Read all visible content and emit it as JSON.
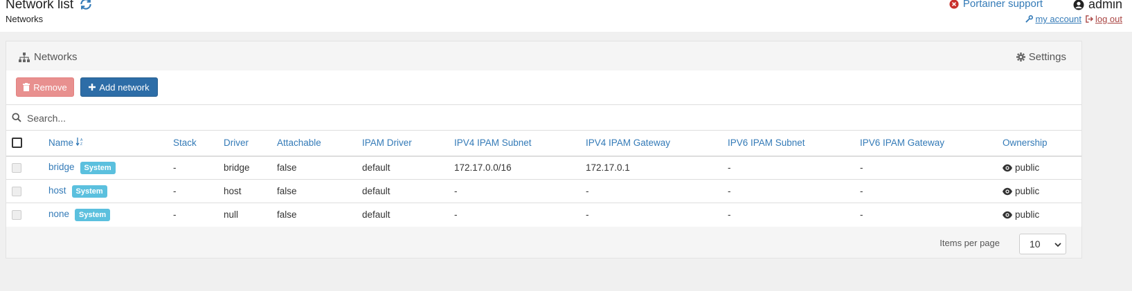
{
  "header": {
    "title": "Network list",
    "breadcrumb": "Networks",
    "support_label": "Portainer support",
    "username": "admin",
    "my_account": "my account",
    "log_out": "log out"
  },
  "panel": {
    "title": "Networks",
    "settings_label": "Settings",
    "remove_label": "Remove",
    "add_label": "Add network",
    "search_placeholder": "Search..."
  },
  "table": {
    "columns": [
      "Name",
      "Stack",
      "Driver",
      "Attachable",
      "IPAM Driver",
      "IPV4 IPAM Subnet",
      "IPV4 IPAM Gateway",
      "IPV6 IPAM Subnet",
      "IPV6 IPAM Gateway",
      "Ownership"
    ],
    "rows": [
      {
        "name": "bridge",
        "badge": "System",
        "stack": "-",
        "driver": "bridge",
        "attachable": "false",
        "ipam_driver": "default",
        "ipv4_subnet": "172.17.0.0/16",
        "ipv4_gateway": "172.17.0.1",
        "ipv6_subnet": "-",
        "ipv6_gateway": "-",
        "ownership": "public"
      },
      {
        "name": "host",
        "badge": "System",
        "stack": "-",
        "driver": "host",
        "attachable": "false",
        "ipam_driver": "default",
        "ipv4_subnet": "-",
        "ipv4_gateway": "-",
        "ipv6_subnet": "-",
        "ipv6_gateway": "-",
        "ownership": "public"
      },
      {
        "name": "none",
        "badge": "System",
        "stack": "-",
        "driver": "null",
        "attachable": "false",
        "ipam_driver": "default",
        "ipv4_subnet": "-",
        "ipv4_gateway": "-",
        "ipv6_subnet": "-",
        "ipv6_gateway": "-",
        "ownership": "public"
      }
    ]
  },
  "footer": {
    "items_per_page_label": "Items per page",
    "items_per_page_value": "10"
  },
  "colors": {
    "link": "#337ab7",
    "primary_button": "#2d6da7",
    "danger_button": "#e8908f",
    "badge": "#5bc0de",
    "logout": "#a94442"
  },
  "icons": {
    "refresh": "refresh-icon",
    "support": "times-circle-icon",
    "user": "user-circle-icon",
    "wrench": "wrench-icon",
    "logout": "sign-out-icon",
    "sitemap": "sitemap-icon",
    "settings": "gear-icon",
    "trash": "trash-icon",
    "plus": "plus-icon",
    "search": "search-icon",
    "sort": "sort-alpha-icon",
    "eye": "eye-icon"
  }
}
